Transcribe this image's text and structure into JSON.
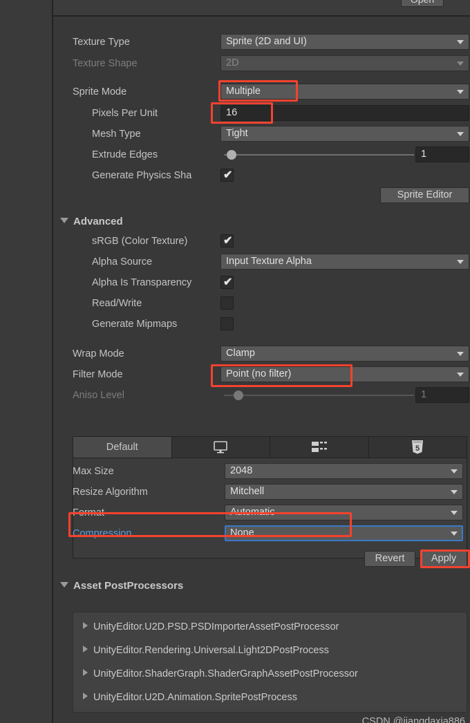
{
  "window": {
    "open_button": "Open",
    "watermark": "CSDN @jiangdaxia886"
  },
  "texture_import_settings": {
    "rows": [
      {
        "label": "Texture Type",
        "value": "Sprite (2D and UI)",
        "type": "dropdown"
      },
      {
        "label": "Texture Shape",
        "value": "2D",
        "type": "dropdown-disabled"
      },
      {
        "label": "Sprite Mode",
        "value": "Multiple",
        "type": "dropdown"
      },
      {
        "label": "Pixels Per Unit",
        "value": "16",
        "type": "number"
      },
      {
        "label": "Mesh Type",
        "value": "Tight",
        "type": "dropdown"
      },
      {
        "label": "Extrude Edges",
        "value": "1",
        "type": "slider"
      },
      {
        "label": "Generate Physics Sha",
        "value": "checked",
        "type": "checkbox"
      }
    ],
    "sprite_editor_button": "Sprite Editor"
  },
  "advanced": {
    "title": "Advanced",
    "rows": [
      {
        "label": "sRGB (Color Texture)",
        "value": "checked",
        "type": "checkbox"
      },
      {
        "label": "Alpha Source",
        "value": "Input Texture Alpha",
        "type": "dropdown"
      },
      {
        "label": "Alpha Is Transparency",
        "value": "checked",
        "type": "checkbox"
      },
      {
        "label": "Read/Write",
        "value": "unchecked",
        "type": "checkbox"
      },
      {
        "label": "Generate Mipmaps",
        "value": "unchecked",
        "type": "checkbox"
      }
    ]
  },
  "filtering": {
    "rows": [
      {
        "label": "Wrap Mode",
        "value": "Clamp",
        "type": "dropdown"
      },
      {
        "label": "Filter Mode",
        "value": "Point (no filter)",
        "type": "dropdown"
      },
      {
        "label": "Aniso Level",
        "value": "1",
        "type": "slider-disabled"
      }
    ]
  },
  "platform_tabs": [
    {
      "label": "Default",
      "icon": "none",
      "active": true
    },
    {
      "label": "",
      "icon": "monitor-icon",
      "active": false
    },
    {
      "label": "",
      "icon": "android-icon",
      "active": false
    },
    {
      "label": "",
      "icon": "html5-icon",
      "active": false
    }
  ],
  "platform_settings": {
    "rows": [
      {
        "label": "Max Size",
        "value": "2048",
        "type": "dropdown"
      },
      {
        "label": "Resize Algorithm",
        "value": "Mitchell",
        "type": "dropdown"
      },
      {
        "label": "Format",
        "value": "Automatic",
        "type": "dropdown"
      },
      {
        "label": "Compression",
        "value": "None",
        "type": "dropdown-selected"
      }
    ]
  },
  "actions": {
    "revert": "Revert",
    "apply": "Apply"
  },
  "asset_postprocessors": {
    "title": "Asset PostProcessors",
    "items": [
      "UnityEditor.U2D.PSD.PSDImporterAssetPostProcessor",
      "UnityEditor.Rendering.Universal.Light2DPostProcess",
      "UnityEditor.ShaderGraph.ShaderGraphAssetPostProcessor",
      "UnityEditor.U2D.Animation.SpritePostProcess"
    ]
  },
  "colors": {
    "background": "#383838",
    "dropdown": "#585858",
    "field": "#282828",
    "accent_selected": "#3a79c6",
    "annotation": "#f5422f",
    "label": "#c4c4c4",
    "label_disabled": "#7d7d7d",
    "label_blue": "#5a9ddd"
  }
}
